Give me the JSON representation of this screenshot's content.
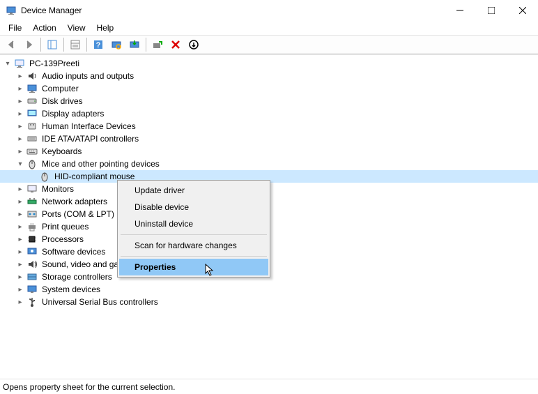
{
  "window": {
    "title": "Device Manager"
  },
  "menubar": {
    "items": [
      "File",
      "Action",
      "View",
      "Help"
    ]
  },
  "tree": {
    "root": "PC-139Preeti",
    "categories": [
      {
        "label": "Audio inputs and outputs",
        "icon": "audio"
      },
      {
        "label": "Computer",
        "icon": "computer"
      },
      {
        "label": "Disk drives",
        "icon": "disk"
      },
      {
        "label": "Display adapters",
        "icon": "display"
      },
      {
        "label": "Human Interface Devices",
        "icon": "hid"
      },
      {
        "label": "IDE ATA/ATAPI controllers",
        "icon": "ide"
      },
      {
        "label": "Keyboards",
        "icon": "keyboard"
      },
      {
        "label": "Mice and other pointing devices",
        "icon": "mouse",
        "expanded": true,
        "children": [
          {
            "label": "HID-compliant mouse",
            "icon": "mouse",
            "selected": true
          }
        ]
      },
      {
        "label": "Monitors",
        "icon": "monitor"
      },
      {
        "label": "Network adapters",
        "icon": "network"
      },
      {
        "label": "Ports (COM & LPT)",
        "icon": "ports"
      },
      {
        "label": "Print queues",
        "icon": "printer"
      },
      {
        "label": "Processors",
        "icon": "processor"
      },
      {
        "label": "Software devices",
        "icon": "software"
      },
      {
        "label": "Sound, video and game controllers",
        "icon": "sound"
      },
      {
        "label": "Storage controllers",
        "icon": "storage"
      },
      {
        "label": "System devices",
        "icon": "system"
      },
      {
        "label": "Universal Serial Bus controllers",
        "icon": "usb"
      }
    ]
  },
  "context_menu": {
    "items": [
      {
        "label": "Update driver",
        "type": "item"
      },
      {
        "label": "Disable device",
        "type": "item"
      },
      {
        "label": "Uninstall device",
        "type": "item"
      },
      {
        "type": "sep"
      },
      {
        "label": "Scan for hardware changes",
        "type": "item"
      },
      {
        "type": "sep"
      },
      {
        "label": "Properties",
        "type": "item",
        "highlighted": true
      }
    ]
  },
  "statusbar": {
    "text": "Opens property sheet for the current selection."
  }
}
